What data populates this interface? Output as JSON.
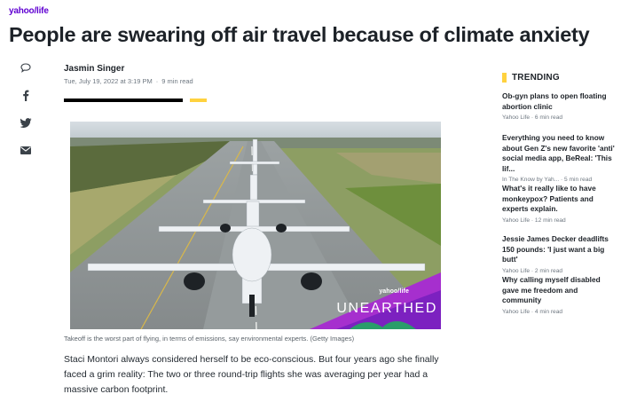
{
  "brand": {
    "logo": "yahoo/life"
  },
  "article": {
    "headline": "People are swearing off air travel because of climate anxiety",
    "author": "Jasmin Singer",
    "date": "Tue, July 19, 2022 at 3:19 PM",
    "read_time": "9 min read",
    "caption": "Takeoff is the worst part of flying, in terms of emissions, say environmental experts. (Getty Images)",
    "body": "Staci Montori always considered herself to be eco-conscious. But four years ago she finally faced a grim reality: The two or three round-trip flights she was averaging per year had a massive carbon footprint."
  },
  "share_icons": [
    "comment-icon",
    "facebook-icon",
    "twitter-icon",
    "email-icon"
  ],
  "image_badge": {
    "brand": "yahoo/life",
    "title": "UNEARTHED"
  },
  "trending": {
    "heading": "TRENDING",
    "items": [
      {
        "title": "Ob-gyn plans to open floating abortion clinic",
        "source": "Yahoo Life · 6 min read"
      },
      {
        "title": "Everything you need to know about Gen Z's new favorite 'anti' social media app, BeReal: 'This lif...",
        "source": "In The Know by Yah... · 5 min read"
      },
      {
        "title": "What's it really like to have monkeypox? Patients and experts explain.",
        "source": "Yahoo Life · 12 min read"
      },
      {
        "title": "Jessie James Decker deadlifts 150 pounds: 'I just want a big butt'",
        "source": "Yahoo Life · 2 min read"
      },
      {
        "title": "Why calling myself disabled gave me freedom and community",
        "source": "Yahoo Life · 4 min read"
      }
    ]
  },
  "colors": {
    "brand_purple": "#6001d2",
    "accent_yellow": "#ffd23f",
    "text_dark": "#1d2228",
    "text_muted": "#6e7780"
  }
}
